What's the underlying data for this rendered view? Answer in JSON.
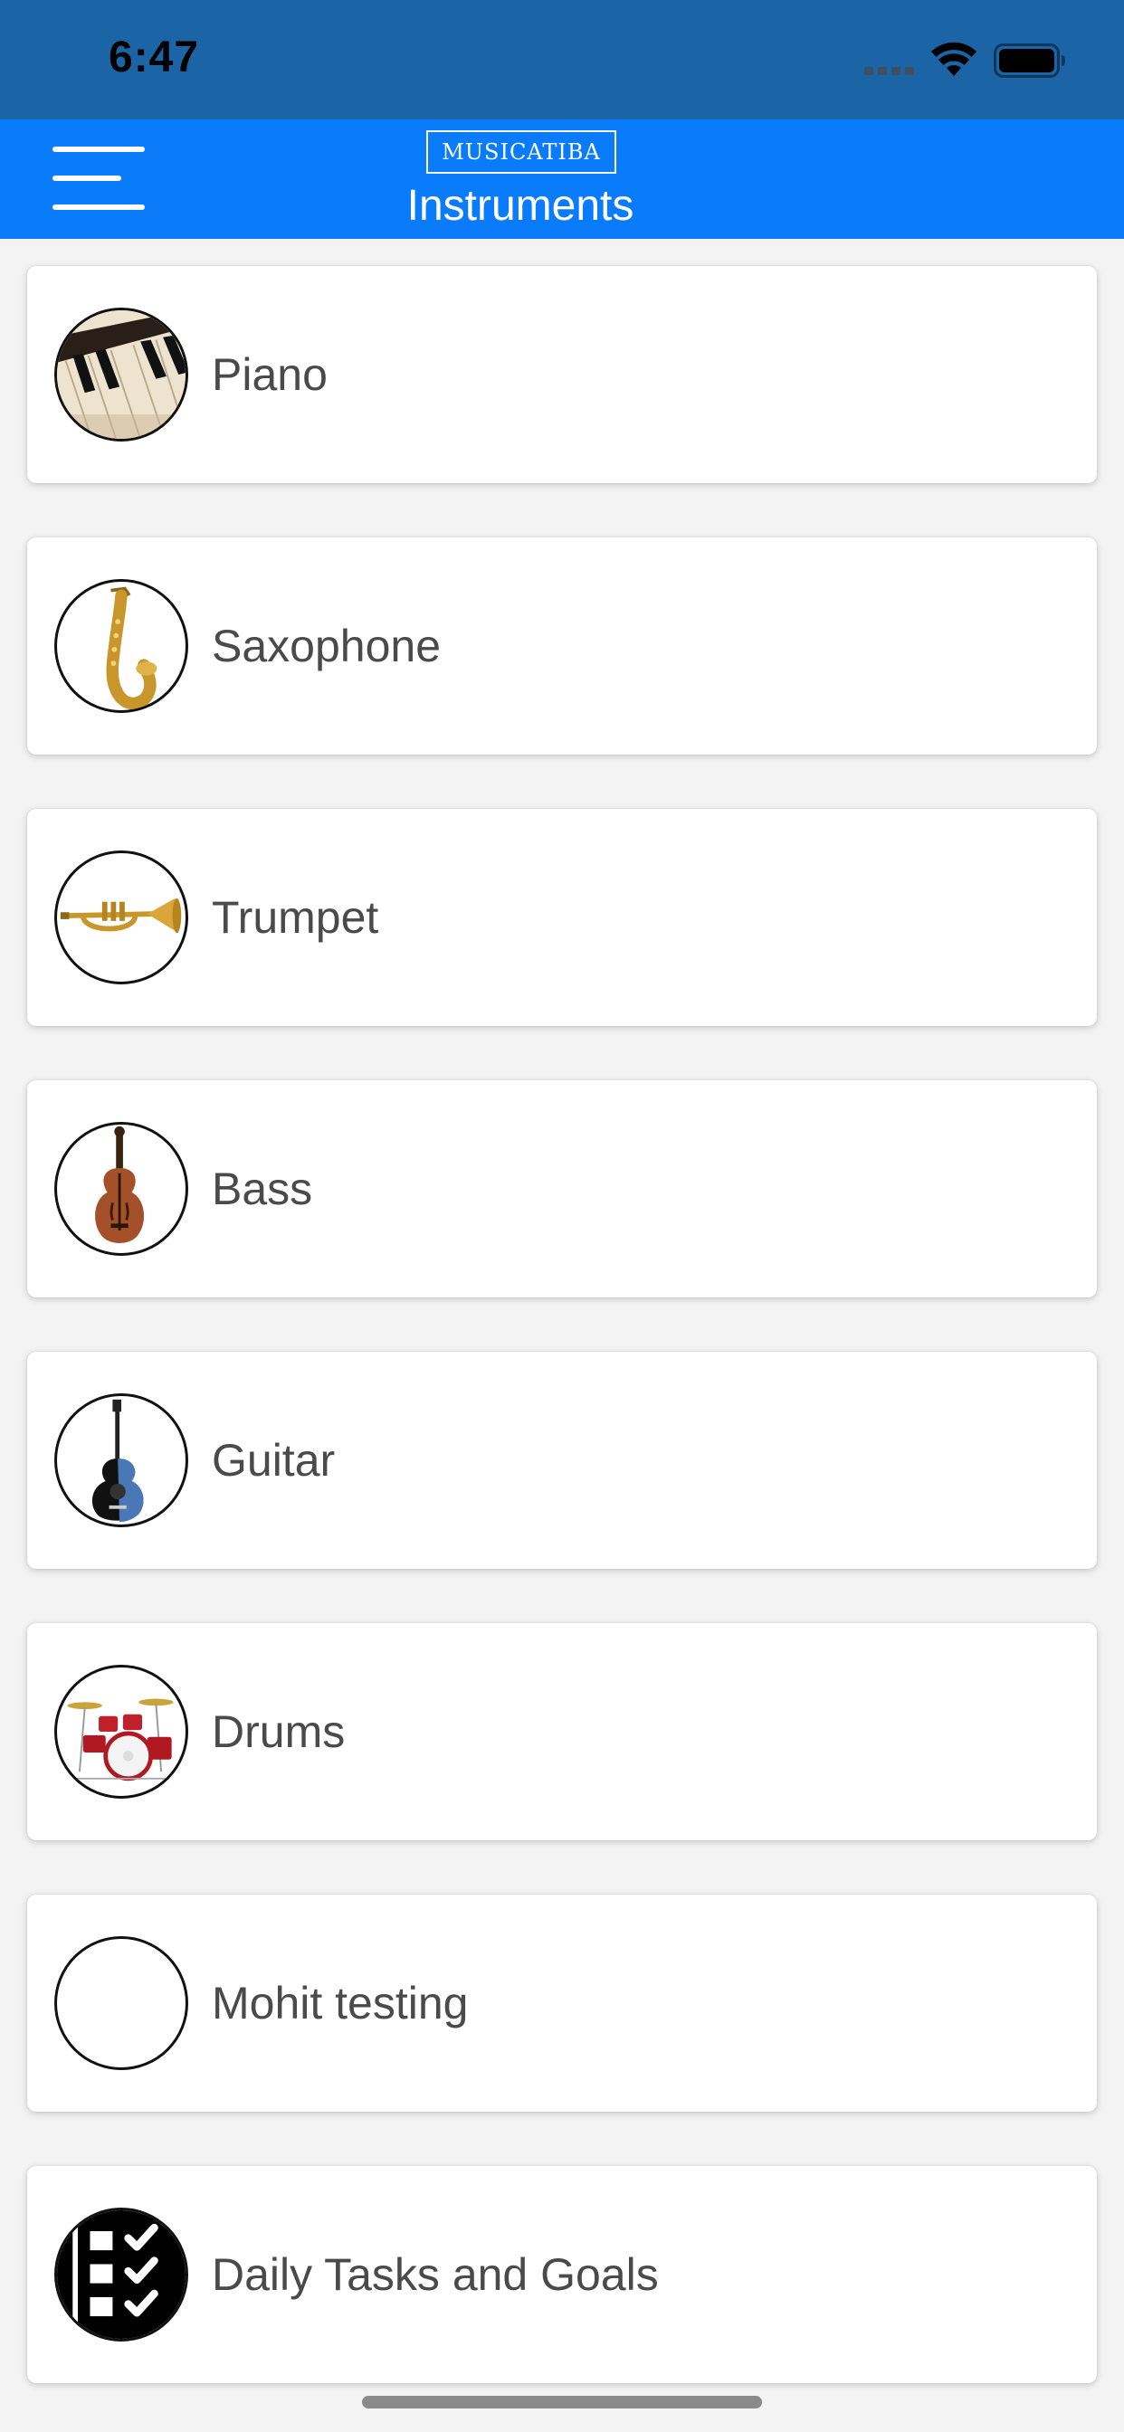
{
  "status_bar": {
    "time": "6:47"
  },
  "header": {
    "brand": "MUSICATIBA",
    "title": "Instruments",
    "menu_icon": "hamburger-menu-icon"
  },
  "instruments": [
    {
      "label": "Piano",
      "icon": "piano-keys-icon"
    },
    {
      "label": "Saxophone",
      "icon": "saxophone-icon"
    },
    {
      "label": "Trumpet",
      "icon": "trumpet-icon"
    },
    {
      "label": "Bass",
      "icon": "double-bass-icon"
    },
    {
      "label": "Guitar",
      "icon": "guitar-icon"
    },
    {
      "label": "Drums",
      "icon": "drum-kit-icon"
    },
    {
      "label": "Mohit testing",
      "icon": "empty-avatar-icon"
    },
    {
      "label": "Daily Tasks and Goals",
      "icon": "checklist-icon"
    }
  ],
  "colors": {
    "status_bar_bg": "#1b64a6",
    "nav_bar_bg": "#0a7cfb",
    "page_bg": "#f3f3f3",
    "card_bg": "#ffffff",
    "label_text": "#4a4a4a"
  }
}
